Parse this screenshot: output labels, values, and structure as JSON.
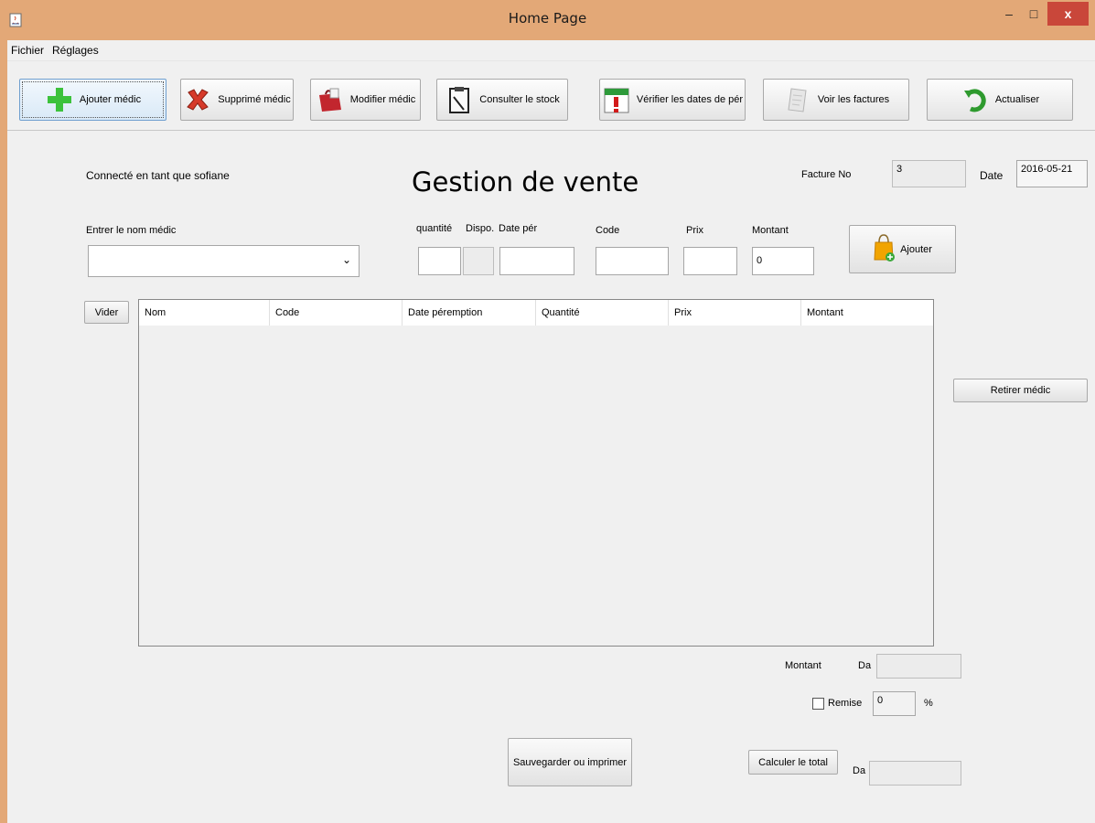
{
  "window": {
    "title": "Home Page",
    "close_glyph": "x",
    "minimize_glyph": "–",
    "maximize_glyph": "□"
  },
  "menu": {
    "items": [
      "Fichier",
      "Réglages"
    ]
  },
  "toolbar": {
    "buttons": [
      {
        "label": "Ajouter médic",
        "icon": "green-plus-icon"
      },
      {
        "label": "Supprimé médic",
        "icon": "red-x-icon"
      },
      {
        "label": "Modifier médic",
        "icon": "red-bag-icon"
      },
      {
        "label": "Consulter le stock",
        "icon": "clipboard-icon"
      },
      {
        "label": "Vérifier les dates de pér",
        "icon": "calendar-icon"
      },
      {
        "label": "Voir les factures",
        "icon": "receipt-icon"
      },
      {
        "label": "Actualiser",
        "icon": "refresh-icon"
      }
    ]
  },
  "header": {
    "connected_label": "Connecté en tant que  sofiane",
    "page_title": "Gestion de vente",
    "facture_label": "Facture No",
    "facture_value": "3",
    "date_label": "Date",
    "date_value": "2016-05-21"
  },
  "form": {
    "medic_label": "Entrer le nom médic",
    "medic_value": "",
    "quantite_label": "quantité",
    "dispo_label": "Dispo.",
    "date_per_label": "Date pér",
    "code_label": "Code",
    "prix_label": "Prix",
    "montant_label": "Montant",
    "montant_value": "0",
    "ajouter_label": "Ajouter"
  },
  "table": {
    "vider_label": "Vider",
    "columns": [
      "Nom",
      "Code",
      "Date péremption",
      "Quantité",
      "Prix",
      "Montant"
    ],
    "rows": []
  },
  "side": {
    "retirer_label": "Retirer médic"
  },
  "summary": {
    "montant_label": "Montant",
    "currency_label": "Da",
    "remise_label": "Remise",
    "remise_value": "0",
    "percent_label": "%",
    "calculer_label": "Calculer le total",
    "total_currency_label": "Da",
    "save_label": "Sauvegarder ou imprimer"
  },
  "colors": {
    "title_bar": "#e3a877",
    "close_button": "#c9473a",
    "window_bg": "#f0f0f0"
  }
}
